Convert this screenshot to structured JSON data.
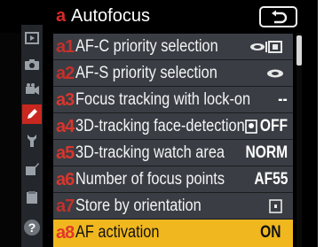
{
  "header": {
    "section_letter": "a",
    "title": "Autofocus"
  },
  "sidebar": {
    "icons": [
      {
        "name": "playback-menu-icon"
      },
      {
        "name": "shooting-menu-icon"
      },
      {
        "name": "movie-menu-icon"
      },
      {
        "name": "custom-settings-pencil-icon",
        "active": true
      },
      {
        "name": "setup-wrench-icon"
      },
      {
        "name": "retouch-menu-icon"
      },
      {
        "name": "my-menu-icon"
      },
      {
        "name": "help-icon",
        "glyph": "?"
      }
    ]
  },
  "menu": {
    "items": [
      {
        "code": "a1",
        "label": "AF-C priority selection",
        "value": "",
        "icon": "release-focus-icon"
      },
      {
        "code": "a2",
        "label": "AF-S priority selection",
        "value": "",
        "icon": "focus-icon"
      },
      {
        "code": "a3",
        "label": "Focus tracking with lock-on",
        "value": "--"
      },
      {
        "code": "a4",
        "label": "3D-tracking face-detection",
        "value": "OFF",
        "icon": "face-detection-off-icon"
      },
      {
        "code": "a5",
        "label": "3D-tracking watch area",
        "value": "NORM"
      },
      {
        "code": "a6",
        "label": "Number of focus points",
        "value": "AF55"
      },
      {
        "code": "a7",
        "label": "Store by orientation",
        "value": "",
        "icon": "focus-point-orientation-icon"
      },
      {
        "code": "a8",
        "label": "AF activation",
        "value": "ON",
        "selected": true
      }
    ]
  },
  "colors": {
    "accent_red": "#d92a25",
    "row_bg": "#3a3d44",
    "selected_bg": "#f0b81e",
    "background": "#000000"
  }
}
